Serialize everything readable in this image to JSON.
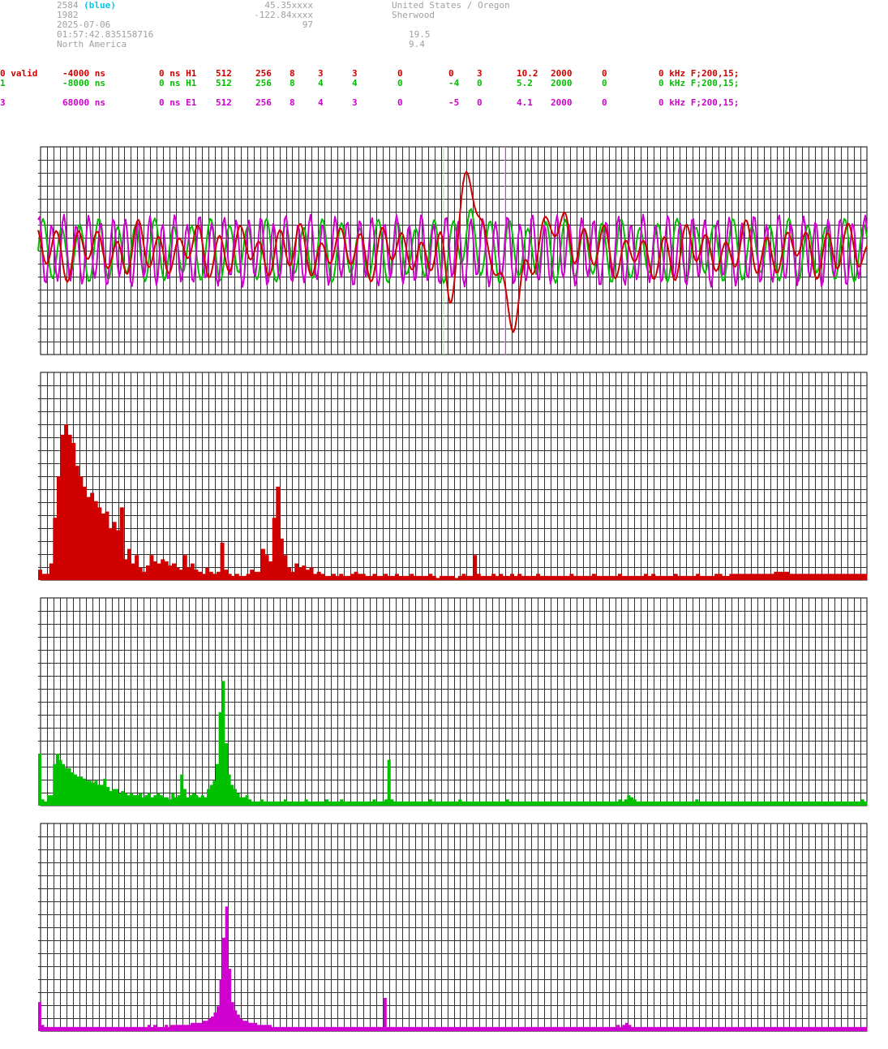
{
  "header": {
    "col1": [
      {
        "text": "2584",
        "suffix": "(blue)"
      },
      {
        "text": "1982"
      },
      {
        "text": "2025-07-06"
      },
      {
        "text": "01:57:42.835158716"
      },
      {
        "text": "North America"
      }
    ],
    "col2": [
      "45.35xxxx",
      "-122.84xxxx",
      "97"
    ],
    "col3": [
      "United States / Oregon",
      "Sherwood"
    ],
    "col4": [
      "19.5",
      "9.4"
    ]
  },
  "channels": [
    {
      "color": "#d00000",
      "cells": [
        "0 valid",
        "-4000 ns",
        "0 ns H1",
        "512",
        "256",
        "8",
        "3",
        "3",
        "0",
        "0",
        "3",
        "10.2",
        "2000",
        "0",
        "0 kHz F;200,15;"
      ]
    },
    {
      "color": "#00c000",
      "cells": [
        "1",
        "-8000 ns",
        "0 ns H1",
        "512",
        "256",
        "8",
        "4",
        "4",
        "0",
        "-4",
        "0",
        "5.2",
        "2000",
        "0",
        "0 kHz F;200,15;"
      ]
    },
    {
      "color": "#d000d0",
      "cells": [
        "3",
        "68000 ns",
        "0 ns E1",
        "512",
        "256",
        "8",
        "4",
        "3",
        "0",
        "-5",
        "0",
        "4.1",
        "2000",
        "0",
        "0 kHz F;200,15;"
      ]
    }
  ],
  "chart_data": [
    {
      "type": "line",
      "title": "",
      "grid": true,
      "ylim": [
        -16,
        16
      ],
      "x_count": 512,
      "markers": [
        {
          "x": 250,
          "color": "#a0e8a0"
        },
        {
          "x": 288,
          "color": "#f0a0f0"
        }
      ],
      "series": [
        {
          "color": "#00c000",
          "kind": "carrier",
          "period": 11.5,
          "amp": 4.2,
          "offset": 0,
          "features": [
            {
              "x": 265,
              "w": 4,
              "a": 4
            }
          ]
        },
        {
          "color": "#d000d0",
          "kind": "carrier",
          "period": 7.6,
          "amp": 4.8,
          "offset": 0,
          "features": []
        },
        {
          "color": "#d00000",
          "kind": "pulse",
          "period": 12.5,
          "amp": 2.8,
          "offset": 0,
          "features": [
            {
              "x": 253,
              "w": 4,
              "a": -7
            },
            {
              "x": 266,
              "w": 6,
              "a": 13
            },
            {
              "x": 285,
              "w": 5,
              "a": -5
            },
            {
              "x": 294,
              "w": 7,
              "a": -8
            },
            {
              "x": 318,
              "w": 5,
              "a": 4
            },
            {
              "x": 326,
              "w": 4,
              "a": 5
            },
            {
              "x": 377,
              "w": 5,
              "a": -3
            }
          ]
        }
      ]
    },
    {
      "type": "bar",
      "color": "#d00000",
      "grid": true,
      "ylim": [
        0,
        100
      ],
      "values": [
        5,
        3,
        3,
        8,
        30,
        50,
        70,
        75,
        70,
        66,
        55,
        50,
        45,
        40,
        42,
        38,
        35,
        32,
        33,
        25,
        28,
        24,
        35,
        10,
        15,
        8,
        12,
        6,
        4,
        7,
        12,
        9,
        8,
        10,
        9,
        7,
        8,
        6,
        5,
        12,
        6,
        8,
        5,
        4,
        3,
        6,
        4,
        3,
        4,
        18,
        5,
        3,
        2,
        3,
        2,
        2,
        3,
        5,
        4,
        4,
        15,
        12,
        9,
        30,
        45,
        20,
        12,
        6,
        4,
        8,
        6,
        7,
        5,
        6,
        3,
        4,
        3,
        2,
        2,
        3,
        2,
        3,
        2,
        2,
        3,
        4,
        3,
        3,
        2,
        2,
        3,
        2,
        2,
        3,
        2,
        2,
        3,
        2,
        2,
        2,
        3,
        2,
        2,
        2,
        2,
        3,
        2,
        1,
        2,
        2,
        2,
        2,
        1,
        2,
        3,
        2,
        2,
        12,
        3,
        2,
        2,
        2,
        3,
        2,
        3,
        2,
        2,
        3,
        2,
        3,
        2,
        2,
        2,
        2,
        3,
        2,
        2,
        2,
        2,
        2,
        2,
        2,
        2,
        3,
        2,
        2,
        2,
        2,
        2,
        3,
        2,
        2,
        2,
        2,
        2,
        2,
        3,
        2,
        2,
        2,
        2,
        2,
        2,
        3,
        2,
        3,
        2,
        2,
        2,
        2,
        2,
        3,
        2,
        2,
        2,
        2,
        2,
        3,
        2,
        2,
        2,
        2,
        3,
        3,
        2,
        2,
        3,
        3,
        3,
        3,
        3,
        3,
        3,
        3,
        3,
        3,
        3,
        3,
        4,
        4,
        4,
        4,
        3,
        3,
        3,
        3,
        3,
        3,
        3,
        3,
        3,
        3,
        3,
        3,
        3,
        3,
        3,
        3,
        3,
        3,
        3,
        3,
        3
      ]
    },
    {
      "type": "bar",
      "color": "#00c000",
      "grid": true,
      "ylim": [
        0,
        100
      ],
      "values": [
        25,
        3,
        2,
        5,
        5,
        20,
        25,
        22,
        20,
        18,
        18,
        16,
        15,
        14,
        14,
        13,
        12,
        12,
        11,
        12,
        10,
        10,
        13,
        9,
        7,
        8,
        8,
        6,
        7,
        6,
        5,
        6,
        5,
        5,
        6,
        4,
        5,
        6,
        4,
        5,
        6,
        5,
        4,
        4,
        3,
        6,
        4,
        5,
        15,
        8,
        4,
        5,
        6,
        5,
        4,
        5,
        4,
        8,
        10,
        12,
        20,
        45,
        60,
        30,
        15,
        10,
        8,
        6,
        4,
        4,
        5,
        3,
        2,
        2,
        2,
        3,
        2,
        2,
        2,
        2,
        2,
        2,
        2,
        3,
        2,
        2,
        2,
        2,
        2,
        2,
        3,
        2,
        2,
        2,
        2,
        2,
        2,
        3,
        2,
        2,
        2,
        2,
        3,
        2,
        2,
        2,
        2,
        2,
        2,
        2,
        2,
        2,
        2,
        3,
        2,
        2,
        2,
        3,
        22,
        3,
        2,
        2,
        2,
        2,
        2,
        2,
        2,
        2,
        2,
        2,
        2,
        2,
        3,
        2,
        2,
        2,
        2,
        2,
        2,
        2,
        2,
        2,
        3,
        2,
        2,
        2,
        2,
        2,
        2,
        2,
        2,
        2,
        2,
        2,
        2,
        2,
        2,
        2,
        3,
        2,
        2,
        2,
        2,
        2,
        2,
        2,
        2,
        2,
        2,
        2,
        2,
        2,
        2,
        2,
        2,
        2,
        2,
        2,
        2,
        2,
        2,
        2,
        2,
        2,
        2,
        2,
        2,
        2,
        2,
        2,
        2,
        2,
        2,
        2,
        2,
        2,
        3,
        2,
        3,
        5,
        4,
        3,
        2,
        2,
        2,
        2,
        2,
        2,
        2,
        2,
        2,
        2,
        2,
        2,
        2,
        2,
        2,
        2,
        2,
        2,
        2,
        2,
        3,
        2,
        2,
        2,
        2,
        2,
        2,
        2,
        2,
        2,
        2,
        2,
        2,
        2,
        2,
        2,
        2,
        2,
        2,
        2,
        2,
        2,
        2,
        2,
        2,
        2,
        2,
        2,
        2,
        2,
        2,
        2,
        2,
        2,
        2,
        2,
        2,
        2,
        2,
        2,
        2,
        2,
        2,
        2,
        2,
        2,
        2,
        2,
        2,
        2,
        2,
        2,
        2,
        2,
        2,
        2,
        3,
        2
      ]
    },
    {
      "type": "bar",
      "color": "#d000d0",
      "grid": true,
      "ylim": [
        0,
        100
      ],
      "values": [
        14,
        3,
        2,
        2,
        2,
        2,
        2,
        2,
        2,
        2,
        2,
        2,
        2,
        2,
        2,
        2,
        2,
        2,
        2,
        2,
        2,
        2,
        2,
        2,
        2,
        2,
        2,
        2,
        2,
        2,
        2,
        2,
        2,
        2,
        2,
        2,
        2,
        2,
        3,
        2,
        3,
        2,
        2,
        2,
        3,
        2,
        3,
        3,
        3,
        3,
        3,
        3,
        3,
        4,
        4,
        4,
        4,
        5,
        5,
        6,
        7,
        9,
        12,
        25,
        45,
        60,
        30,
        14,
        10,
        8,
        6,
        5,
        5,
        4,
        4,
        4,
        3,
        3,
        3,
        3,
        3,
        2,
        2,
        2,
        2,
        2,
        2,
        2,
        2,
        2,
        2,
        2,
        2,
        2,
        2,
        2,
        2,
        2,
        2,
        2,
        2,
        2,
        2,
        2,
        2,
        2,
        2,
        2,
        2,
        2,
        2,
        2,
        2,
        2,
        2,
        2,
        2,
        2,
        2,
        2,
        16,
        2,
        2,
        2,
        2,
        2,
        2,
        2,
        2,
        2,
        2,
        2,
        2,
        2,
        2,
        2,
        2,
        2,
        2,
        2,
        2,
        2,
        2,
        2,
        2,
        2,
        2,
        2,
        2,
        2,
        2,
        2,
        2,
        2,
        2,
        2,
        2,
        2,
        2,
        2,
        2,
        2,
        2,
        2,
        2,
        2,
        2,
        2,
        2,
        2,
        2,
        2,
        2,
        2,
        2,
        2,
        2,
        2,
        2,
        2,
        2,
        2,
        2,
        2,
        2,
        2,
        2,
        2,
        2,
        2,
        2,
        2,
        2,
        2,
        2,
        2,
        2,
        2,
        2,
        2,
        2,
        3,
        2,
        3,
        4,
        3,
        2,
        2,
        2,
        2,
        2,
        2,
        2,
        2,
        2,
        2,
        2,
        2,
        2,
        2,
        2,
        2,
        2,
        2,
        2,
        2,
        2,
        2,
        2,
        2,
        2,
        2,
        2,
        2,
        2,
        2,
        2,
        2,
        2,
        2,
        2,
        2,
        2,
        2,
        2,
        2,
        2,
        2,
        2,
        2,
        2,
        2,
        2,
        2,
        2,
        2,
        2,
        2,
        2,
        2,
        2,
        2,
        2,
        2,
        2,
        2,
        2,
        2,
        2,
        2,
        2,
        2,
        2,
        2,
        2,
        2,
        2,
        2,
        2,
        2,
        2,
        2,
        2,
        2,
        2,
        2,
        2,
        2
      ]
    }
  ]
}
